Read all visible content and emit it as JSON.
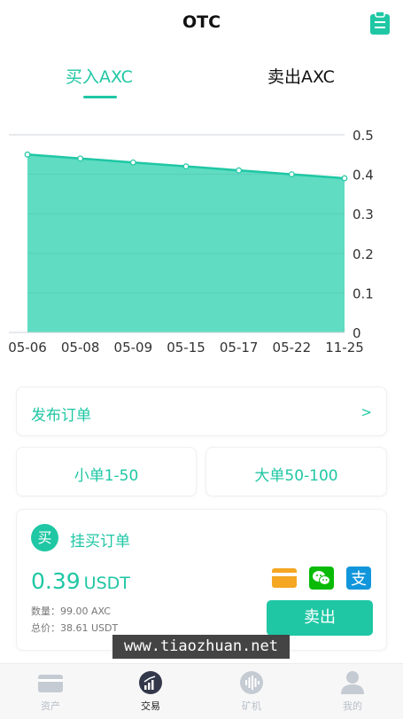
{
  "header": {
    "title": "OTC",
    "clipboard_icon": "clipboard-icon"
  },
  "tabs": [
    {
      "label": "买入AXC",
      "active": true
    },
    {
      "label": "卖出AXC",
      "active": false
    }
  ],
  "chart_data": {
    "type": "area",
    "categories": [
      "05-06",
      "05-08",
      "05-09",
      "05-15",
      "05-17",
      "05-22",
      "11-25"
    ],
    "values": [
      0.45,
      0.44,
      0.43,
      0.42,
      0.41,
      0.4,
      0.39
    ],
    "yticks": [
      0,
      0.1,
      0.2,
      0.3,
      0.4,
      0.5
    ],
    "ylim": [
      0,
      0.5
    ],
    "grid": true,
    "colors": {
      "fill": "#5fdcc2",
      "line": "#1fc7a4"
    }
  },
  "actions": {
    "publish_label": "发布订单",
    "publish_chevron": ">",
    "small_order": "小单1-50",
    "large_order": "大单50-100"
  },
  "order": {
    "badge": "买",
    "title": "挂买订单",
    "price": "0.39",
    "unit": "USDT",
    "quantity": "数量：99.00 AXC",
    "total": "总价：38.61 USDT",
    "sell_label": "卖出",
    "payment_icons": [
      "bank-card-icon",
      "wechat-pay-icon",
      "alipay-icon"
    ]
  },
  "watermark": "www.tiaozhuan.net",
  "tabbar": [
    {
      "label": "资产",
      "icon": "wallet-card-icon",
      "active": false
    },
    {
      "label": "交易",
      "icon": "trade-chart-icon",
      "active": true
    },
    {
      "label": "矿机",
      "icon": "mining-wave-icon",
      "active": false
    },
    {
      "label": "我的",
      "icon": "user-icon",
      "active": false
    }
  ],
  "colors": {
    "accent": "#1fc7a4",
    "inactive": "#b8bfc9"
  }
}
